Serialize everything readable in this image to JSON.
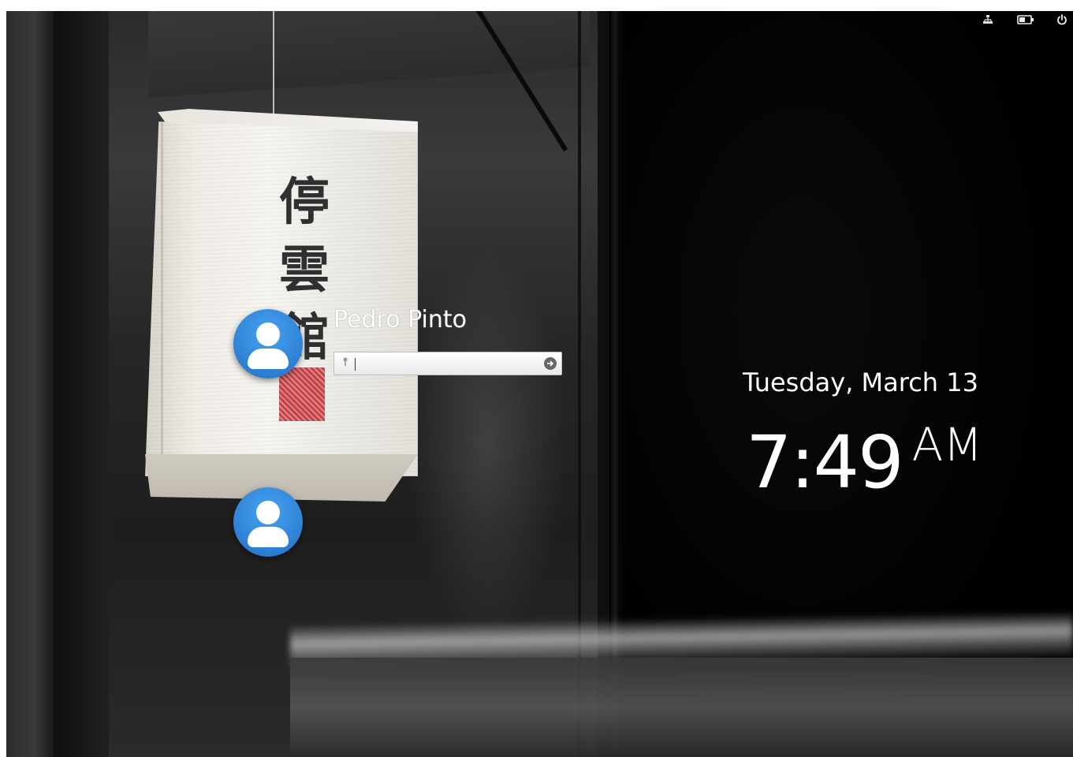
{
  "top_bar": {
    "icons": {
      "network": "network-icon",
      "battery": "battery-icon",
      "power": "power-icon"
    }
  },
  "wallpaper": {
    "lantern_text": "停雲館"
  },
  "users": [
    {
      "name": "Pedro Pinto",
      "avatar_icon": "user-avatar-icon",
      "selected": true
    },
    {
      "name": "",
      "avatar_icon": "user-avatar-icon",
      "selected": false
    }
  ],
  "login": {
    "password_value": "",
    "key_icon": "key-icon",
    "submit_icon": "arrow-right-icon"
  },
  "clock": {
    "date": "Tuesday, March 13",
    "time": "7:49",
    "ampm": "AM"
  },
  "colors": {
    "avatar_blue": "#2d7fd3",
    "text": "#ffffff"
  }
}
